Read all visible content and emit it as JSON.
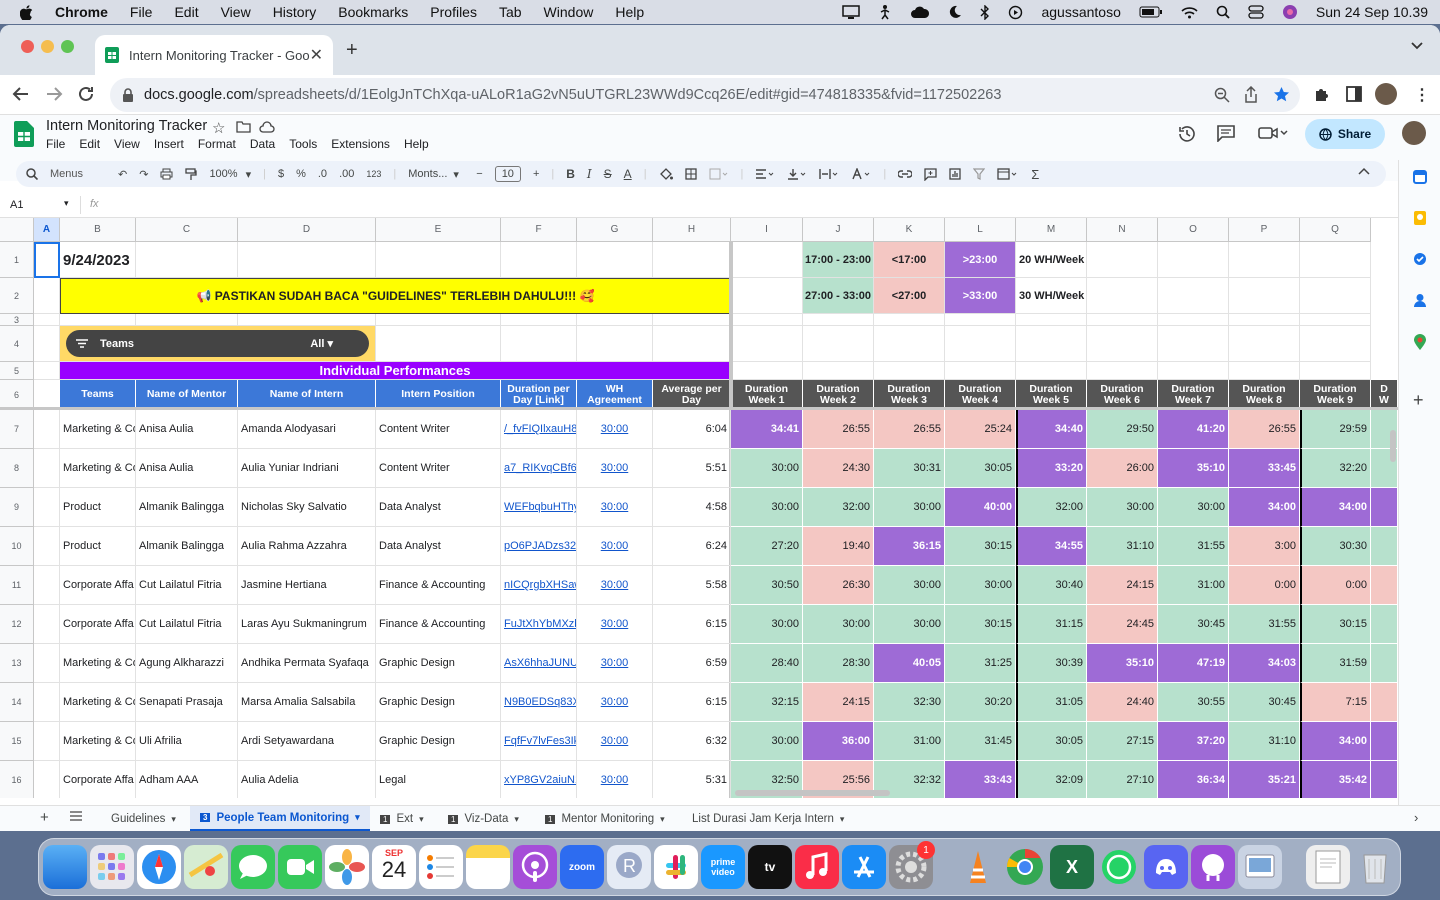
{
  "menubar": {
    "app": "Chrome",
    "items": [
      "File",
      "Edit",
      "View",
      "History",
      "Bookmarks",
      "Profiles",
      "Tab",
      "Window",
      "Help"
    ],
    "user": "agussantoso",
    "datetime": "Sun 24 Sep  10.39"
  },
  "browser": {
    "tab_title": "Intern Monitoring Tracker - Goo",
    "url_host": "docs.google.com",
    "url_path": "/spreadsheets/d/1EolgJnTChXqa-uALoR1aG2vN5uUTGRL23WWd9Ccq26E/edit#gid=474818335&fvid=1172502263"
  },
  "sheets": {
    "title": "Intern Monitoring Tracker",
    "menus": [
      "File",
      "Edit",
      "View",
      "Insert",
      "Format",
      "Data",
      "Tools",
      "Extensions",
      "Help"
    ],
    "share_label": "Share",
    "toolbar": {
      "menus_search": "Menus",
      "zoom": "100%",
      "currency": "$",
      "percent": "%",
      "dec_less": ".0",
      "dec_more": ".00",
      "format_123": "123",
      "font": "Monts...",
      "font_size": "10"
    },
    "name_box": "A1",
    "fx": "fx"
  },
  "grid": {
    "columns": [
      "A",
      "B",
      "C",
      "D",
      "E",
      "F",
      "G",
      "H",
      "I",
      "J",
      "K",
      "L",
      "M",
      "N",
      "O",
      "P",
      "Q"
    ],
    "row_numbers": [
      "1",
      "2",
      "3",
      "4",
      "5",
      "6",
      "7",
      "8",
      "9",
      "10",
      "11",
      "12",
      "13",
      "14",
      "15",
      "16"
    ],
    "date": "9/24/2023",
    "banner": "📢 PASTIKAN SUDAH BACA \"GUIDELINES\" TERLEBIH DAHULU!!! 🥰",
    "filter_label": "Teams",
    "filter_value": "All",
    "section_title": "Individual Performances",
    "legend": {
      "r1": [
        "17:00 - 23:00",
        "<17:00",
        ">23:00",
        "20 WH/Week"
      ],
      "r2": [
        "27:00 - 33:00",
        "<27:00",
        ">33:00",
        "30 WH/Week"
      ]
    },
    "headers": [
      "Teams",
      "Name of Mentor",
      "Name of Intern",
      "Intern Position",
      "Duration per Day [Link]",
      "WH Agreement",
      "Average per Day"
    ],
    "week_headers": [
      "Duration Week 1",
      "Duration Week 2",
      "Duration Week 3",
      "Duration Week 4",
      "Duration Week 5",
      "Duration Week 6",
      "Duration Week 7",
      "Duration Week 8",
      "Duration Week 9",
      "D W"
    ],
    "rows": [
      {
        "team": "Marketing & Co",
        "mentor": "Anisa Aulia",
        "intern": "Amanda Alodyasari",
        "position": "Content Writer",
        "link": "/_fvFIQIlxauH8",
        "wh": "30:00",
        "avg": "6:04",
        "weeks": [
          "34:41",
          "26:55",
          "26:55",
          "25:24",
          "34:40",
          "29:50",
          "41:20",
          "26:55",
          "29:59"
        ],
        "colors": [
          "p",
          "r",
          "r",
          "r",
          "p",
          "g",
          "p",
          "r",
          "g"
        ]
      },
      {
        "team": "Marketing & Co",
        "mentor": "Anisa Aulia",
        "intern": "Aulia Yuniar Indriani",
        "position": "Content Writer",
        "link": "a7_RIKvqCBf6u",
        "wh": "30:00",
        "avg": "5:51",
        "weeks": [
          "30:00",
          "24:30",
          "30:31",
          "30:05",
          "33:20",
          "26:00",
          "35:10",
          "33:45",
          "32:20"
        ],
        "colors": [
          "g",
          "r",
          "g",
          "g",
          "p",
          "r",
          "p",
          "p",
          "g"
        ]
      },
      {
        "team": "Product",
        "mentor": "Almanik Balingga",
        "intern": "Nicholas Sky Salvatio",
        "position": "Data Analyst",
        "link": "WEFbqbuHThy",
        "wh": "30:00",
        "avg": "4:58",
        "weeks": [
          "30:00",
          "32:00",
          "30:00",
          "40:00",
          "32:00",
          "30:00",
          "30:00",
          "34:00",
          "34:00"
        ],
        "colors": [
          "g",
          "g",
          "g",
          "p",
          "g",
          "g",
          "g",
          "p",
          "p"
        ]
      },
      {
        "team": "Product",
        "mentor": "Almanik Balingga",
        "intern": "Aulia Rahma Azzahra",
        "position": "Data Analyst",
        "link": "pO6PJADzs32H",
        "wh": "30:00",
        "avg": "6:24",
        "weeks": [
          "27:20",
          "19:40",
          "36:15",
          "30:15",
          "34:55",
          "31:10",
          "31:55",
          "3:00",
          "30:30"
        ],
        "colors": [
          "g",
          "r",
          "p",
          "g",
          "p",
          "g",
          "g",
          "r",
          "g"
        ]
      },
      {
        "team": "Corporate Affa",
        "mentor": "Cut Lailatul Fitria",
        "intern": "Jasmine Hertiana",
        "position": "Finance & Accounting",
        "link": "nICQrgbXHSaw",
        "wh": "30:00",
        "avg": "5:58",
        "weeks": [
          "30:50",
          "26:30",
          "30:00",
          "30:00",
          "30:40",
          "24:15",
          "31:00",
          "0:00",
          "0:00"
        ],
        "colors": [
          "g",
          "r",
          "g",
          "g",
          "g",
          "r",
          "g",
          "r",
          "r"
        ]
      },
      {
        "team": "Corporate Affa",
        "mentor": "Cut Lailatul Fitria",
        "intern": "Laras Ayu Sukmaningrum",
        "position": "Finance & Accounting",
        "link": "FuJtXhYbMXzb",
        "wh": "30:00",
        "avg": "6:15",
        "weeks": [
          "30:00",
          "30:00",
          "30:00",
          "30:15",
          "31:15",
          "24:45",
          "30:45",
          "31:55",
          "30:15"
        ],
        "colors": [
          "g",
          "g",
          "g",
          "g",
          "g",
          "r",
          "g",
          "g",
          "g"
        ]
      },
      {
        "team": "Marketing & Co",
        "mentor": "Agung Alkharazzi",
        "intern": "Andhika Permata Syafaqa",
        "position": "Graphic Design",
        "link": "AsX6hhaJUNUl",
        "wh": "30:00",
        "avg": "6:59",
        "weeks": [
          "28:40",
          "28:30",
          "40:05",
          "31:25",
          "30:39",
          "35:10",
          "47:19",
          "34:03",
          "31:59"
        ],
        "colors": [
          "g",
          "g",
          "p",
          "g",
          "g",
          "p",
          "p",
          "p",
          "g"
        ]
      },
      {
        "team": "Marketing & Co",
        "mentor": "Senapati Prasaja",
        "intern": "Marsa Amalia Salsabila",
        "position": "Graphic Design",
        "link": "N9B0EDSq83Xu",
        "wh": "30:00",
        "avg": "6:15",
        "weeks": [
          "32:15",
          "24:15",
          "32:30",
          "30:20",
          "31:05",
          "24:40",
          "30:55",
          "30:45",
          "7:15"
        ],
        "colors": [
          "g",
          "r",
          "g",
          "g",
          "g",
          "r",
          "g",
          "g",
          "r"
        ]
      },
      {
        "team": "Marketing & Co",
        "mentor": "Uli Afrilia",
        "intern": "Ardi Setyawardana",
        "position": "Graphic Design",
        "link": "FqfFv7lvFes3Ike",
        "wh": "30:00",
        "avg": "6:32",
        "weeks": [
          "30:00",
          "36:00",
          "31:00",
          "31:45",
          "30:05",
          "27:15",
          "37:20",
          "31:10",
          "34:00"
        ],
        "colors": [
          "g",
          "p",
          "g",
          "g",
          "g",
          "g",
          "p",
          "g",
          "p"
        ]
      },
      {
        "team": "Corporate Affa",
        "mentor": "Adham AAA",
        "intern": "Aulia Adelia",
        "position": "Legal",
        "link": "xYP8GV2aiuN15",
        "wh": "30:00",
        "avg": "5:31",
        "weeks": [
          "32:50",
          "25:56",
          "32:32",
          "33:43",
          "32:09",
          "27:10",
          "36:34",
          "35:21",
          "35:42"
        ],
        "colors": [
          "g",
          "r",
          "g",
          "p",
          "g",
          "g",
          "p",
          "p",
          "p"
        ]
      }
    ]
  },
  "sheet_tabs": {
    "tabs": [
      "Guidelines",
      "People Team Monitoring",
      "Ext",
      "Viz-Data",
      "Mentor Monitoring",
      "List Durasi Jam Kerja Intern"
    ],
    "badges": [
      "",
      "3",
      "1",
      "1",
      "1",
      ""
    ],
    "active": "People Team Monitoring"
  },
  "dock": {
    "calendar_month": "SEP",
    "calendar_day": "24",
    "settings_badge": "1"
  },
  "colors": {
    "green": "#b7e1cd",
    "pink": "#f4c7c3",
    "purple": "#9e6bd6",
    "header_blue": "#3c78d8",
    "banner_yellow": "#ffff00",
    "section_purple": "#9900ff"
  }
}
